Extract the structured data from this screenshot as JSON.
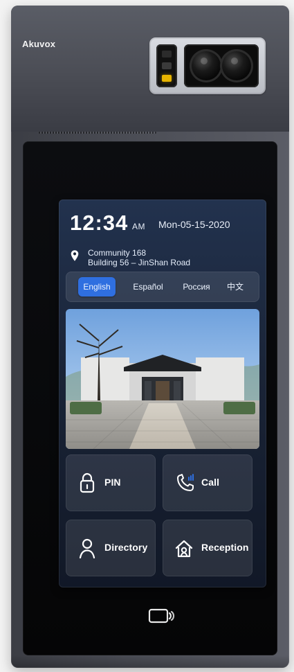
{
  "brand": {
    "name": "Akuvox"
  },
  "screen": {
    "time": "12:34",
    "ampm": "AM",
    "date": "Mon-05-15-2020",
    "location": {
      "line1": "Community 168",
      "line2": "Building 56 – JinShan Road"
    },
    "languages": [
      {
        "label": "English",
        "active": true
      },
      {
        "label": "Español",
        "active": false
      },
      {
        "label": "Россия",
        "active": false
      },
      {
        "label": "中文",
        "active": false
      }
    ],
    "tiles": {
      "pin": {
        "label": "PIN",
        "icon": "lock-icon"
      },
      "call": {
        "label": "Call",
        "icon": "phone-icon"
      },
      "directory": {
        "label": "Directory",
        "icon": "user-icon"
      },
      "reception": {
        "label": "Reception",
        "icon": "home-person-icon"
      }
    }
  },
  "device": {
    "nfc_icon": "nfc-card-icon",
    "camera_module": "dual-camera-module"
  },
  "colors": {
    "accent": "#2f6fe0",
    "screen_bg_top": "#22324e",
    "screen_bg_bottom": "#111827"
  }
}
